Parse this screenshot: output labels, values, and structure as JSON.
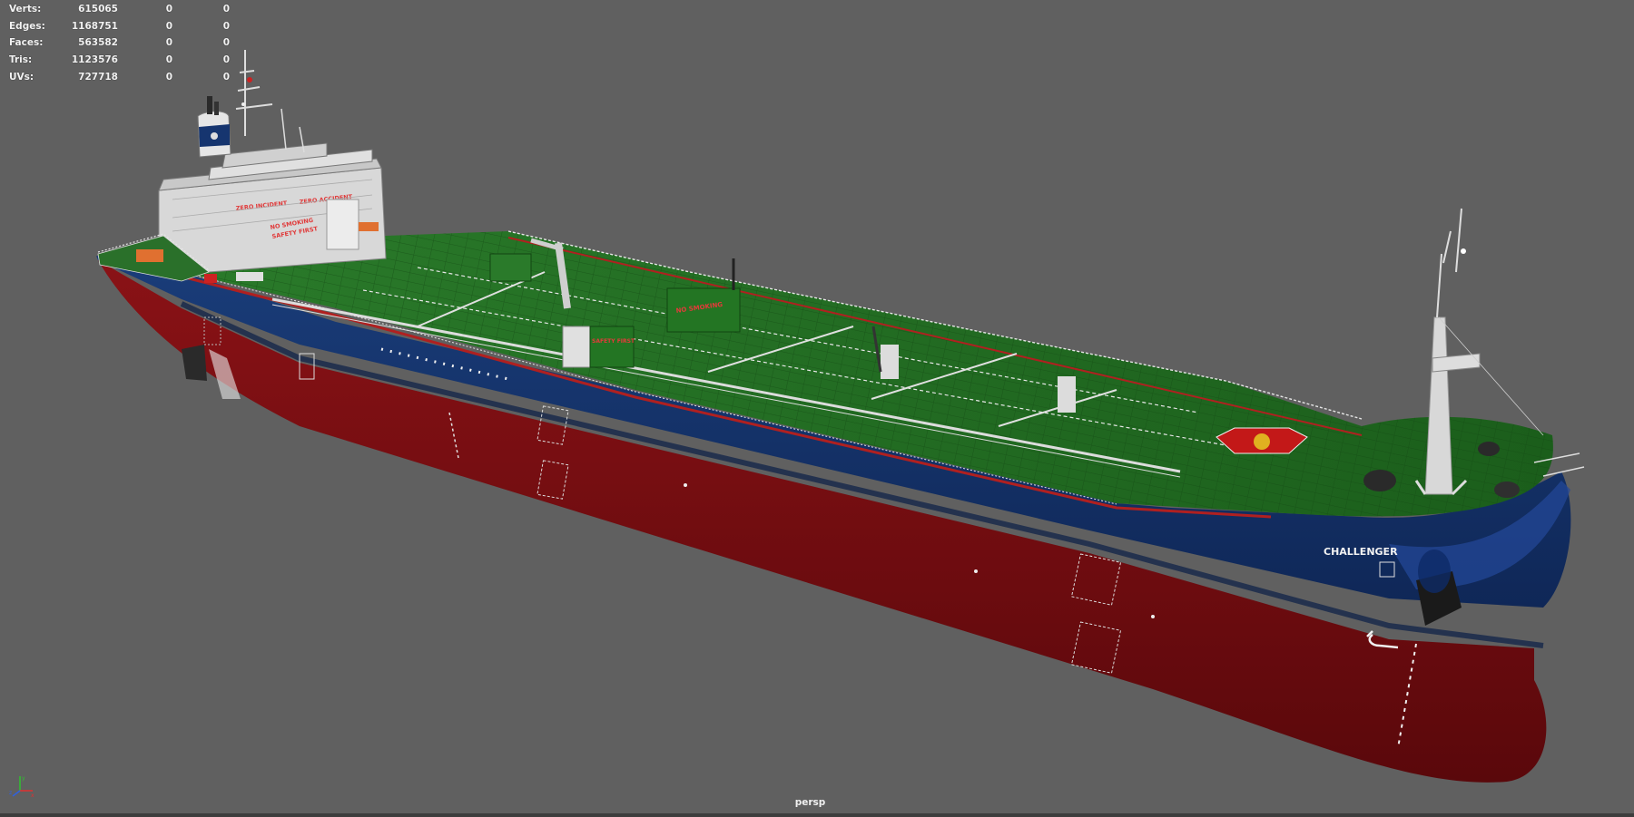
{
  "hud": {
    "rows": [
      {
        "label": "Verts:",
        "v1": "615065",
        "v2": "0",
        "v3": "0"
      },
      {
        "label": "Edges:",
        "v1": "1168751",
        "v2": "0",
        "v3": "0"
      },
      {
        "label": "Faces:",
        "v1": "563582",
        "v2": "0",
        "v3": "0"
      },
      {
        "label": "Tris:",
        "v1": "1123576",
        "v2": "0",
        "v3": "0"
      },
      {
        "label": "UVs:",
        "v1": "727718",
        "v2": "0",
        "v3": "0"
      }
    ]
  },
  "ship": {
    "name": "CHALLENGER",
    "slogan_1": "ZERO INCIDENT",
    "slogan_2": "ZERO ACCIDENT",
    "slogan_3": "NO SMOKING",
    "slogan_4": "SAFETY FIRST",
    "slogan_5": "SAFETY FIRST",
    "slogan_6": "NO SMOKING",
    "colors": {
      "hull_top": "#123068",
      "hull_bottom": "#7a0c10",
      "deck": "#1f6a1f",
      "superstructure": "#d8d8d8"
    }
  },
  "viewport": {
    "camera": "persp",
    "background": "#606060"
  },
  "axis": {
    "x_color": "#e03030",
    "y_color": "#30c030",
    "z_color": "#3060e0"
  }
}
